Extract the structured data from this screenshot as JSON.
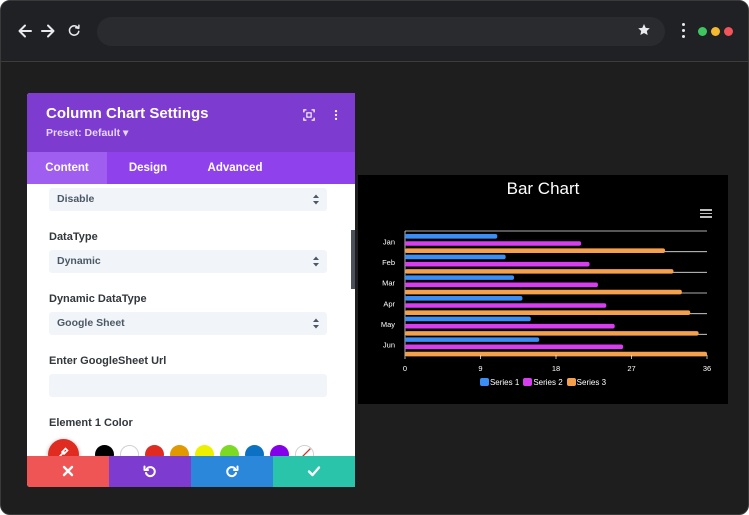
{
  "panel": {
    "title": "Column Chart Settings",
    "preset": "Preset: Default ▾",
    "tabs": [
      {
        "label": "Content",
        "active": true
      },
      {
        "label": "Design",
        "active": false
      },
      {
        "label": "Advanced",
        "active": false
      }
    ],
    "fields": {
      "top_select_value": "Disable",
      "datatype_label": "DataType",
      "datatype_value": "Dynamic",
      "dynamic_datatype_label": "Dynamic DataType",
      "dynamic_datatype_value": "Google Sheet",
      "sheet_url_label": "Enter GoogleSheet Url",
      "sheet_url_value": "",
      "element1_color_label": "Element 1 Color"
    },
    "color_swatches": [
      "#e02b20",
      "#000000",
      "#ffffff",
      "#e02b20",
      "#e09900",
      "#edf000",
      "#7cda24",
      "#0c71c3",
      "#8300e9"
    ],
    "footer_colors": {
      "cancel": "#ef5555",
      "undo": "#7e3bd0",
      "redo": "#2b87da",
      "save": "#29c4a9"
    }
  },
  "colors": {
    "header": "#7e3bd0",
    "tabs": "#8f42ec"
  },
  "chart_data": {
    "type": "bar",
    "orientation": "horizontal",
    "title": "Bar Chart",
    "categories": [
      "Jan",
      "Feb",
      "Mar",
      "Apr",
      "May",
      "Jun"
    ],
    "series": [
      {
        "name": "Series 1",
        "color": "#3a8ef6",
        "values": [
          11,
          12,
          13,
          14,
          15,
          16
        ]
      },
      {
        "name": "Series 2",
        "color": "#d63ef0",
        "values": [
          21,
          22,
          23,
          24,
          25,
          26
        ]
      },
      {
        "name": "Series 3",
        "color": "#f5a04c",
        "values": [
          31,
          32,
          33,
          34,
          35,
          36
        ]
      }
    ],
    "xticks": [
      0,
      9,
      18,
      27,
      36
    ],
    "xlim": [
      0,
      36
    ],
    "legend_position": "bottom",
    "grid": true
  }
}
